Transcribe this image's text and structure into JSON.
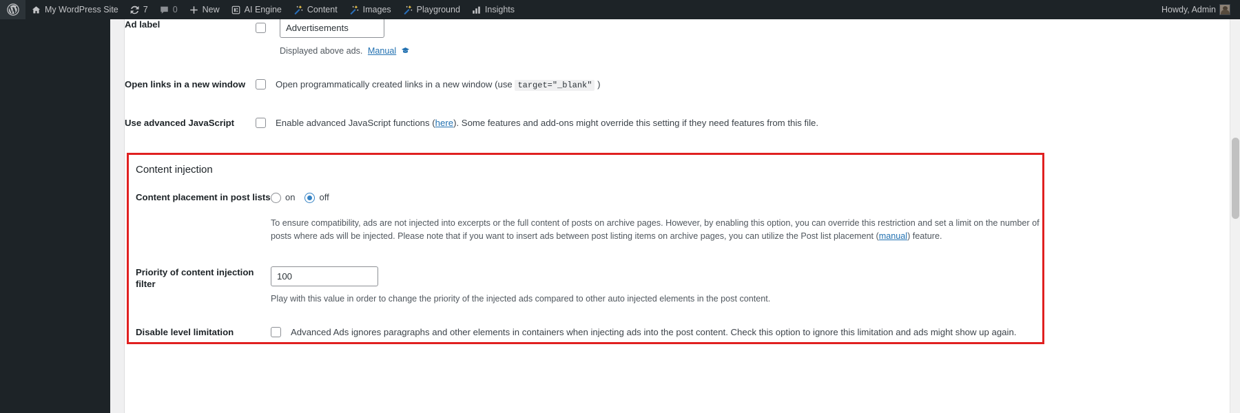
{
  "adminbar": {
    "logo_icon": "wordpress-logo-icon",
    "items": [
      {
        "icon": "home-icon",
        "label": "My WordPress Site"
      },
      {
        "icon": "updates-icon",
        "label": "7"
      },
      {
        "icon": "comments-icon",
        "label": "0"
      },
      {
        "icon": "plus-icon",
        "label": "New"
      },
      {
        "icon": "ai-engine-icon",
        "label": "AI Engine"
      },
      {
        "icon": "magic-wand-icon",
        "label": "Content"
      },
      {
        "icon": "magic-wand-icon",
        "label": "Images"
      },
      {
        "icon": "magic-wand-icon",
        "label": "Playground"
      },
      {
        "icon": "bar-chart-icon",
        "label": "Insights"
      }
    ],
    "howdy": "Howdy, Admin",
    "avatar": "user-avatar"
  },
  "settings": {
    "ad_label": {
      "label": "Ad label",
      "checkbox_checked": false,
      "input_value": "Advertisements",
      "desc_prefix": "Displayed above ads.",
      "manual_link": "Manual",
      "manual_icon": "graduation-cap-icon"
    },
    "open_links": {
      "label": "Open links in a new window",
      "checkbox_checked": false,
      "desc_before": "Open programmatically created links in a new window (use",
      "code": "target=\"_blank\"",
      "desc_after": ")"
    },
    "advanced_js": {
      "label": "Use advanced JavaScript",
      "checkbox_checked": false,
      "desc_before": "Enable advanced JavaScript functions (",
      "link": "here",
      "desc_after": "). Some features and add-ons might override this setting if they need features from this file."
    }
  },
  "content_injection": {
    "section_title": "Content injection",
    "placement": {
      "label": "Content placement in post lists",
      "options": [
        {
          "value": "on",
          "label": "on",
          "selected": false
        },
        {
          "value": "off",
          "label": "off",
          "selected": true
        }
      ],
      "description": "To ensure compatibility, ads are not injected into excerpts or the full content of posts on archive pages. However, by enabling this option, you can override this restriction and set a limit on the number of posts where ads will be injected. Please note that if you want to insert ads between post listing items on archive pages, you can utilize the Post list placement (",
      "description_link": "manual",
      "description_after": ") feature."
    },
    "priority": {
      "label": "Priority of content injection filter",
      "value": "100",
      "description": "Play with this value in order to change the priority of the injected ads compared to other auto injected elements in the post content."
    },
    "level_limitation": {
      "label": "Disable level limitation",
      "checkbox_checked": false,
      "description": "Advanced Ads ignores paragraphs and other elements in containers when injecting ads into the post content. Check this option to ignore this limitation and ads might show up again."
    }
  },
  "colors": {
    "adminbar_bg": "#1d2327",
    "link": "#2271b1",
    "highlight_border": "#e02020",
    "radio_accent": "#3582c4"
  }
}
